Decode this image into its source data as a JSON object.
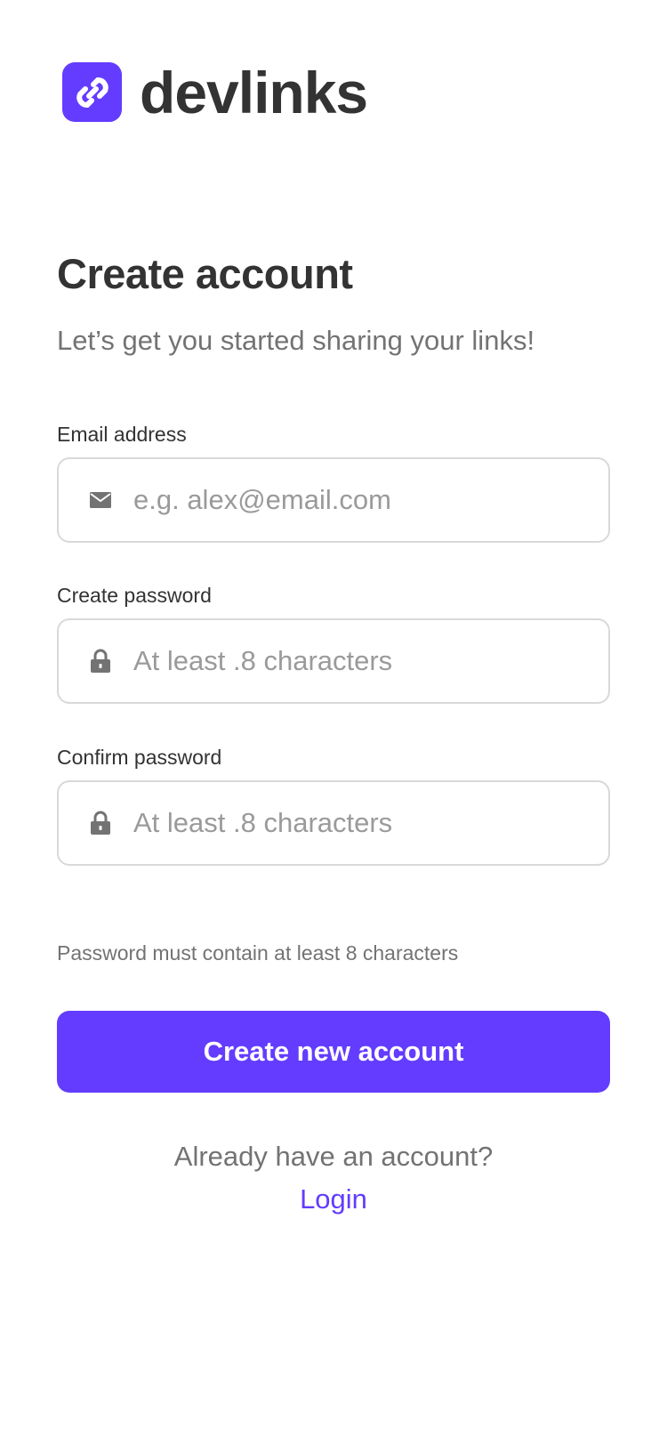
{
  "brand": {
    "name": "devlinks",
    "logo_icon": "link-icon",
    "accent_color": "#633cff"
  },
  "header": {
    "title": "Create account",
    "subtitle": "Let’s get you started sharing your links!"
  },
  "form": {
    "email": {
      "label": "Email address",
      "placeholder": "e.g. alex@email.com",
      "value": "",
      "icon": "mail-icon"
    },
    "password": {
      "label": "Create password",
      "placeholder": "At least .8 characters",
      "value": "",
      "icon": "lock-icon"
    },
    "confirm_password": {
      "label": "Confirm password",
      "placeholder": "At least .8 characters",
      "value": "",
      "icon": "lock-icon"
    },
    "hint": "Password must contain at least 8 characters",
    "submit_label": "Create new account"
  },
  "footer": {
    "prompt": "Already have an account?",
    "login_label": "Login"
  }
}
